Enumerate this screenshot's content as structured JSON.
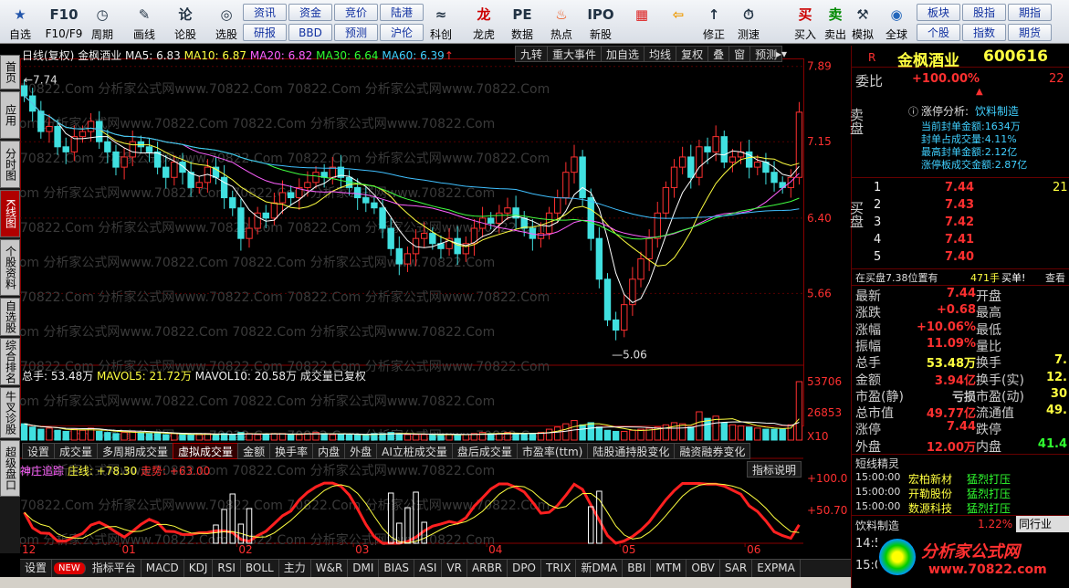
{
  "toolbar": {
    "items": [
      {
        "label": "自选",
        "icon": "star-icon"
      },
      {
        "label": "F10/F9",
        "icon": "f10-icon"
      },
      {
        "label": "周期",
        "icon": "clock-icon"
      },
      {
        "label": "画线",
        "icon": "pen-icon"
      },
      {
        "label": "论股",
        "icon": "discuss-icon"
      },
      {
        "label": "选股",
        "icon": "select-icon"
      },
      {
        "label": "科创",
        "icon": "kc-icon"
      },
      {
        "label": "龙虎",
        "icon": "dragon-icon"
      },
      {
        "label": "数据",
        "icon": "pe-icon"
      },
      {
        "label": "热点",
        "icon": "fire-icon"
      },
      {
        "label": "新股",
        "icon": "ipo-icon"
      },
      {
        "label": "",
        "icon": "color-grid-icon"
      },
      {
        "label": "",
        "icon": "back-arrow-icon"
      },
      {
        "label": "修正",
        "icon": "fix-icon"
      },
      {
        "label": "测速",
        "icon": "speed-icon"
      },
      {
        "label": "买入",
        "icon": "buy-icon"
      },
      {
        "label": "卖出",
        "icon": "sell-icon"
      },
      {
        "label": "模拟",
        "icon": "hammer-icon"
      },
      {
        "label": "全球",
        "icon": "globe-icon"
      }
    ],
    "quick": [
      "资讯",
      "资金",
      "竞价",
      "陆港",
      "研报",
      "BBD",
      "预测",
      "沪伦",
      "板块",
      "股指",
      "期指",
      "个股",
      "指数",
      "期货"
    ],
    "tb_glyphs": {
      "f10": "F10",
      "fix": "↑",
      "speed": "⏱",
      "buy": "买",
      "sell": "卖",
      "ipo": "IPO",
      "kc": "≈",
      "pe": "PE",
      "dragon": "龙"
    }
  },
  "left_tabs": [
    "首页",
    "应用",
    "分时图",
    "K线图",
    "个股资料",
    "自选股",
    "综合排名",
    "牛叉诊股",
    "超级盘口"
  ],
  "chart_header": {
    "period": "日线(复权)",
    "name": "金枫酒业",
    "ma5": "MA5: 6.83",
    "ma10": "MA10: 6.87",
    "ma20": "MA20: 6.82",
    "ma30": "MA30: 6.64",
    "ma60": "MA60: 6.39",
    "buttons": [
      "九转",
      "重大事件",
      "加自选",
      "均线",
      "复权",
      "叠",
      "窗",
      "预测"
    ],
    "up_arrow": "↑",
    "corner": "▸▾"
  },
  "price_axis": [
    "7.89",
    "7.15",
    "6.40",
    "5.66"
  ],
  "hi_label": "7.74",
  "lo_label": "5.06",
  "volume_header": {
    "total": "总手: 53.48万",
    "mavol5": "MAVOL5: 21.72万",
    "mavol10": "MAVOL10: 20.58万",
    "note": "成交量已复权"
  },
  "volume_axis": [
    "53706",
    "26853",
    "X10"
  ],
  "ind_tabs": [
    "设置",
    "成交量",
    "多周期成交量",
    "虚拟成交量",
    "金额",
    "换手率",
    "内盘",
    "外盘",
    "AI立桩成交量",
    "盘后成交量",
    "市盈率(ttm)",
    "陆股通持股变化",
    "融资融券变化"
  ],
  "ind_header": {
    "name": "神庄追踪",
    "zx": "庄线: +78.30",
    "zs": "走势: +63.00",
    "btn": "指标说明"
  },
  "ind_axis": [
    "+100.0",
    "+50.70"
  ],
  "months": [
    "12",
    "01",
    "02",
    "03",
    "04",
    "05",
    "06"
  ],
  "bottom_tabs": [
    "设置",
    "NEW",
    "指标平台",
    "MACD",
    "KDJ",
    "RSI",
    "BOLL",
    "主力",
    "W&R",
    "DMI",
    "BIAS",
    "ASI",
    "VR",
    "ARBR",
    "DPO",
    "TRIX",
    "新DMA",
    "BBI",
    "MTM",
    "OBV",
    "SAR",
    "EXPMA"
  ],
  "right": {
    "title": "金枫酒业",
    "code": "600616",
    "r": "R",
    "weibi_label": "委比",
    "weibi": "+100.00%",
    "weibi_extra": "22",
    "sell_label": "卖盘",
    "buy_label": "买盘",
    "limit_title": "涨停分析:",
    "limit_sector": "饮料制造",
    "limit_lines": [
      "当前封单金额:1634万",
      "封单占成交量:4.11%",
      "最高封单金额:2.12亿",
      "涨停板成交金额:2.87亿"
    ],
    "bids": [
      {
        "n": "1",
        "p": "7.44",
        "v": "21"
      },
      {
        "n": "2",
        "p": "7.43",
        "v": ""
      },
      {
        "n": "3",
        "p": "7.42",
        "v": ""
      },
      {
        "n": "4",
        "p": "7.41",
        "v": ""
      },
      {
        "n": "5",
        "p": "7.40",
        "v": ""
      }
    ],
    "zaimai": "在买盘7.38位置有",
    "zaimai_v": "471手",
    "maidan": "买单!",
    "chakan": "查看",
    "stats": [
      {
        "l": "最新",
        "v": "7.44",
        "l2": "开盘",
        "v2": ""
      },
      {
        "l": "涨跌",
        "v": "+0.68",
        "l2": "最高",
        "v2": ""
      },
      {
        "l": "涨幅",
        "v": "+10.06%",
        "l2": "最低",
        "v2": ""
      },
      {
        "l": "振幅",
        "v": "11.09%",
        "l2": "量比",
        "v2": ""
      },
      {
        "l": "总手",
        "v": "53.48万",
        "l2": "换手",
        "v2": "7."
      },
      {
        "l": "金额",
        "v": "3.94亿",
        "l2": "换手(实)",
        "v2": "12."
      },
      {
        "l": "市盈(静)",
        "v": "亏损",
        "l2": "市盈(动)",
        "v2": "30"
      },
      {
        "l": "总市值",
        "v": "49.77亿",
        "l2": "流通值",
        "v2": "49."
      },
      {
        "l": "涨停",
        "v": "7.44",
        "l2": "跌停",
        "v2": ""
      },
      {
        "l": "外盘",
        "v": "12.00万",
        "l2": "内盘",
        "v2": "41.4"
      }
    ],
    "news_title": "短线精灵",
    "news": [
      {
        "t": "15:00:00",
        "n": "宏柏新材",
        "s": "猛烈打压"
      },
      {
        "t": "15:00:00",
        "n": "开勒股份",
        "s": "猛烈打压"
      },
      {
        "t": "15:00:00",
        "n": "数源科技",
        "s": "猛烈打压"
      }
    ],
    "sector": "饮料制造",
    "sector_pct": "1.22%",
    "sector_btn": "同行业",
    "time": "14:5",
    "time2": "15:0",
    "logo": "分析家公式网",
    "logo_url": "www.70822.com"
  },
  "watermark": "70822.Com 分析家公式网www.70822.Com",
  "colors": {
    "up": "#ff3030",
    "down": "#40e0e0",
    "ma5": "#ffffff",
    "ma10": "#ffff40",
    "ma20": "#ff60ff",
    "ma30": "#40ff40",
    "ma60": "#40c0ff"
  },
  "chart_data": [
    {
      "type": "candlestick",
      "title": "金枫酒业",
      "ylim": [
        5.06,
        7.89
      ],
      "high": 7.74,
      "low": 5.06,
      "ma": [
        {
          "name": "MA5",
          "value": 6.83
        },
        {
          "name": "MA10",
          "value": 6.87
        },
        {
          "name": "MA20",
          "value": 6.82
        },
        {
          "name": "MA30",
          "value": 6.64
        },
        {
          "name": "MA60",
          "value": 6.39
        }
      ],
      "x": [
        "12",
        "01",
        "02",
        "03",
        "04",
        "05",
        "06"
      ],
      "close": [
        7.6,
        7.45,
        7.25,
        7.3,
        7.1,
        7.05,
        7.2,
        7.25,
        7.35,
        7.15,
        7.05,
        6.9,
        7.0,
        7.15,
        7.1,
        7.05,
        6.9,
        6.8,
        6.95,
        6.85,
        6.7,
        6.75,
        6.9,
        6.8,
        6.6,
        6.5,
        6.2,
        6.3,
        6.45,
        6.4,
        6.55,
        6.65,
        6.6,
        6.7,
        6.75,
        6.85,
        6.8,
        6.9,
        6.8,
        6.7,
        6.6,
        6.55,
        6.5,
        6.3,
        6.1,
        5.95,
        6.05,
        6.2,
        6.25,
        6.15,
        6.1,
        6.2,
        6.05,
        6.15,
        6.3,
        6.4,
        6.35,
        6.45,
        6.5,
        6.4,
        6.3,
        6.2,
        6.25,
        6.45,
        6.6,
        6.85,
        7.0,
        6.6,
        6.2,
        5.8,
        5.4,
        5.3,
        5.55,
        5.8,
        6.0,
        6.2,
        6.45,
        6.7,
        6.9,
        7.0,
        6.8,
        7.1,
        7.05,
        7.2,
        6.95,
        7.0,
        7.05,
        6.9,
        6.95,
        6.85,
        6.75,
        6.7,
        6.8,
        7.44
      ]
    },
    {
      "type": "bar",
      "title": "",
      "values": [
        15,
        12,
        10,
        11,
        9,
        8,
        10,
        9,
        11,
        8,
        7,
        6,
        7,
        8,
        7,
        6,
        6,
        5,
        6,
        5,
        5,
        5,
        6,
        5,
        6,
        5,
        7,
        6,
        5,
        5,
        6,
        6,
        5,
        5,
        6,
        7,
        6,
        5,
        5,
        5,
        5,
        5,
        6,
        6,
        7,
        6,
        5,
        5,
        5,
        5,
        5,
        5,
        5,
        5,
        6,
        7,
        6,
        6,
        7,
        6,
        6,
        6,
        7,
        10,
        12,
        15,
        18,
        14,
        16,
        12,
        9,
        8,
        8,
        9,
        10,
        11,
        12,
        14,
        16,
        15,
        12,
        26,
        20,
        22,
        16,
        14,
        13,
        12,
        11,
        10,
        10,
        10,
        14,
        53.7
      ],
      "ylim": [
        0,
        53.706
      ]
    },
    {
      "type": "line",
      "title": "神庄追踪",
      "series": [
        {
          "name": "庄线",
          "last": 78.3
        },
        {
          "name": "走势",
          "last": 63.0
        }
      ],
      "ylim": [
        0,
        100
      ]
    }
  ]
}
